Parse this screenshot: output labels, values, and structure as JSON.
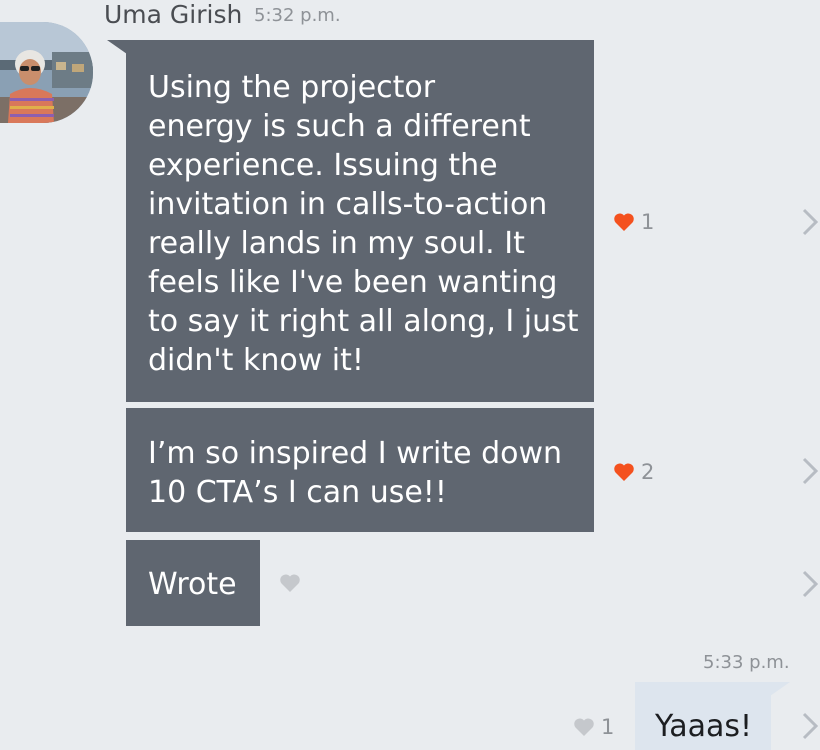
{
  "conversation": {
    "sender": {
      "name": "Uma Girish",
      "time": "5:32 p.m."
    },
    "messages": [
      {
        "text": "Using the projector\nenergy is such a different\nexperience. Issuing the\ninvitation in calls-to-action\nreally lands in my soul. It\nfeels like I've been wanting\nto say it right all along, I just\ndidn't know it!",
        "reaction_count": "1",
        "reacted": true
      },
      {
        "text": "I’m so inspired I write down\n10 CTA’s I can use!!",
        "reaction_count": "2",
        "reacted": true
      },
      {
        "text": "Wrote",
        "reaction_count": "",
        "reacted": false
      }
    ],
    "my_message": {
      "time": "5:33 p.m.",
      "text": "Yaaas!",
      "reaction_count": "1",
      "reacted": false
    }
  },
  "colors": {
    "background": "#e9ecef",
    "incoming_bubble": "#5f6670",
    "outgoing_bubble": "#dde5ee",
    "heart_active": "#f4511e",
    "heart_inactive": "#c5c8cc",
    "chevron": "#b7bcc3"
  },
  "icons": {
    "heart": "heart-icon",
    "chevron": "chevron-right-icon"
  }
}
